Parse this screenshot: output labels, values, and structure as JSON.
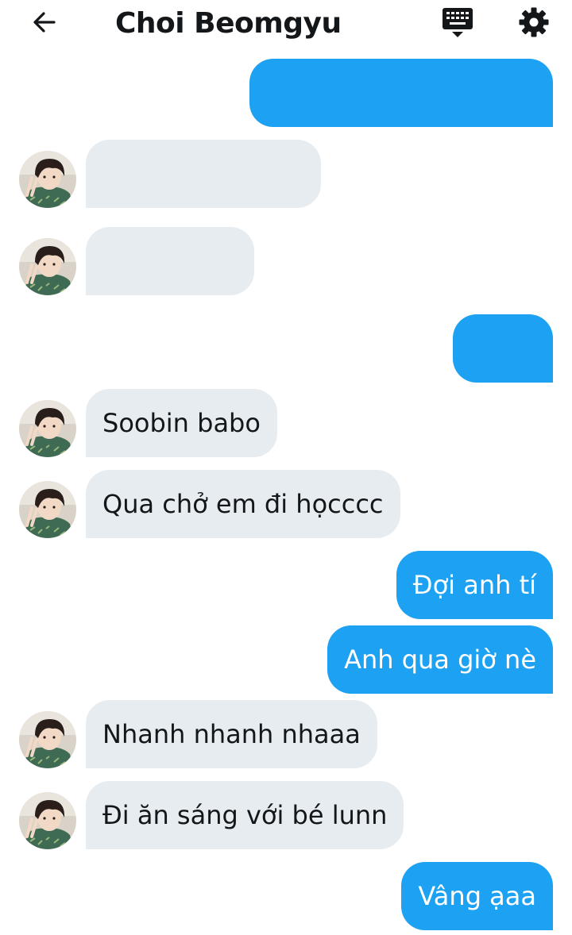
{
  "header": {
    "title": "Choi Beomgyu"
  },
  "icons": {
    "back": "arrow-left-icon",
    "keyboard": "keyboard-icon",
    "settings": "gear-icon"
  },
  "colors": {
    "outgoing_bubble": "#1da1f2",
    "incoming_bubble": "#e6ecf0",
    "outgoing_text": "#ffffff",
    "incoming_text": "#14171a"
  },
  "messages": [
    {
      "sender": "me",
      "text": ""
    },
    {
      "sender": "them",
      "text": ""
    },
    {
      "sender": "them",
      "text": ""
    },
    {
      "sender": "me",
      "text": ""
    },
    {
      "sender": "them",
      "text": "Soobin babo"
    },
    {
      "sender": "them",
      "text": "Qua chở em đi họcccc"
    },
    {
      "sender": "me",
      "text": "Đợi anh tí"
    },
    {
      "sender": "me",
      "text": "Anh qua giờ nè"
    },
    {
      "sender": "them",
      "text": "Nhanh nhanh nhaaa"
    },
    {
      "sender": "them",
      "text": "Đi ăn sáng với bé lunn"
    },
    {
      "sender": "me",
      "text": "Vâng ạaa"
    }
  ]
}
